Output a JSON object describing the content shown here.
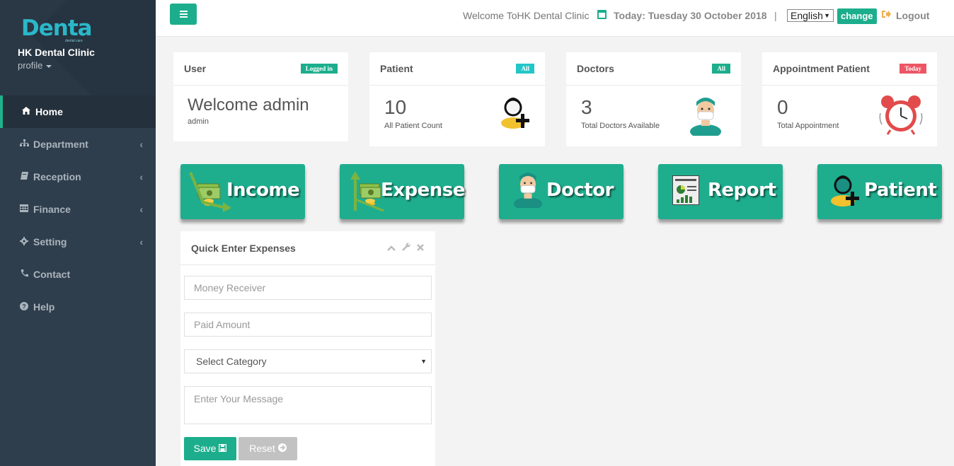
{
  "sidebar": {
    "logo": "Denta",
    "logo_sub": "dental care",
    "clinic_name": "HK Dental Clinic",
    "profile_label": "profile",
    "menu": [
      {
        "label": "Home",
        "icon": "home-icon",
        "active": true
      },
      {
        "label": "Department",
        "icon": "sitemap-icon",
        "has_children": true
      },
      {
        "label": "Reception",
        "icon": "book-icon",
        "has_children": true
      },
      {
        "label": "Finance",
        "icon": "table-icon",
        "has_children": true
      },
      {
        "label": "Setting",
        "icon": "gear-icon",
        "has_children": true
      },
      {
        "label": "Contact",
        "icon": "phone-icon"
      },
      {
        "label": "Help",
        "icon": "question-icon"
      }
    ]
  },
  "header": {
    "welcome": "Welcome ToHK Dental Clinic",
    "today": "Today: Tuesday 30 October 2018",
    "separator": "|",
    "language": "English",
    "change_label": "change",
    "logout_label": "Logout"
  },
  "cards": {
    "user": {
      "title": "User",
      "badge": "Logged in",
      "welcome": "Welcome admin",
      "username": "admin"
    },
    "patient": {
      "title": "Patient",
      "badge": "All",
      "count": "10",
      "subtitle": "All Patient Count"
    },
    "doctors": {
      "title": "Doctors",
      "badge": "All",
      "count": "3",
      "subtitle": "Total Doctors Available"
    },
    "appointment": {
      "title": "Appointment Patient",
      "badge": "Today",
      "count": "0",
      "subtitle": "Total Appointment"
    }
  },
  "shortcuts": [
    {
      "label": "Income",
      "icon": "money-in-icon"
    },
    {
      "label": "Expense",
      "icon": "money-out-icon"
    },
    {
      "label": "Doctor",
      "icon": "doctor-icon"
    },
    {
      "label": "Report",
      "icon": "report-icon"
    },
    {
      "label": "Patient",
      "icon": "add-patient-icon"
    }
  ],
  "quick_expenses": {
    "title": "Quick Enter Expenses",
    "money_receiver_placeholder": "Money Receiver",
    "paid_amount_placeholder": "Paid Amount",
    "category_selected": "Select Category",
    "message_placeholder": "Enter Your Message",
    "save_label": "Save",
    "reset_label": "Reset"
  },
  "colors": {
    "accent": "#1cae8c",
    "sidebar": "#2f3e4c",
    "badge_teal": "#23c6c8",
    "badge_red": "#ed5565"
  }
}
